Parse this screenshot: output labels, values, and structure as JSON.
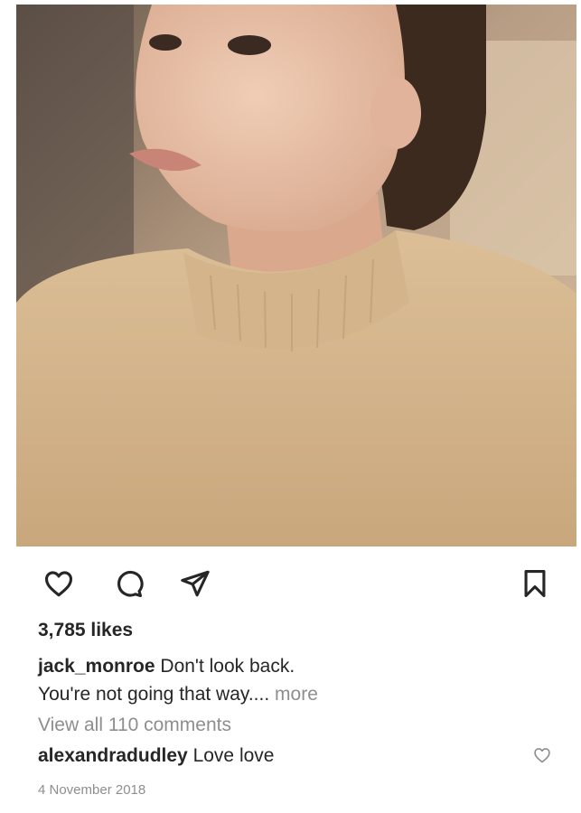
{
  "post": {
    "photo": {
      "description_icon": "portrait-photo"
    },
    "actions": {
      "like_icon": "heart-outline-icon",
      "comment_icon": "comment-bubble-icon",
      "share_icon": "paper-plane-icon",
      "save_icon": "bookmark-icon"
    },
    "likes": "3,785 likes",
    "caption": {
      "username": "jack_monroe",
      "text_line1": "Don't look back.",
      "text_line2": "You're not going that way....",
      "more": "more"
    },
    "view_comments": "View all 110 comments",
    "comment": {
      "username": "alexandradudley",
      "text": "Love love"
    },
    "date": "4 November 2018"
  }
}
